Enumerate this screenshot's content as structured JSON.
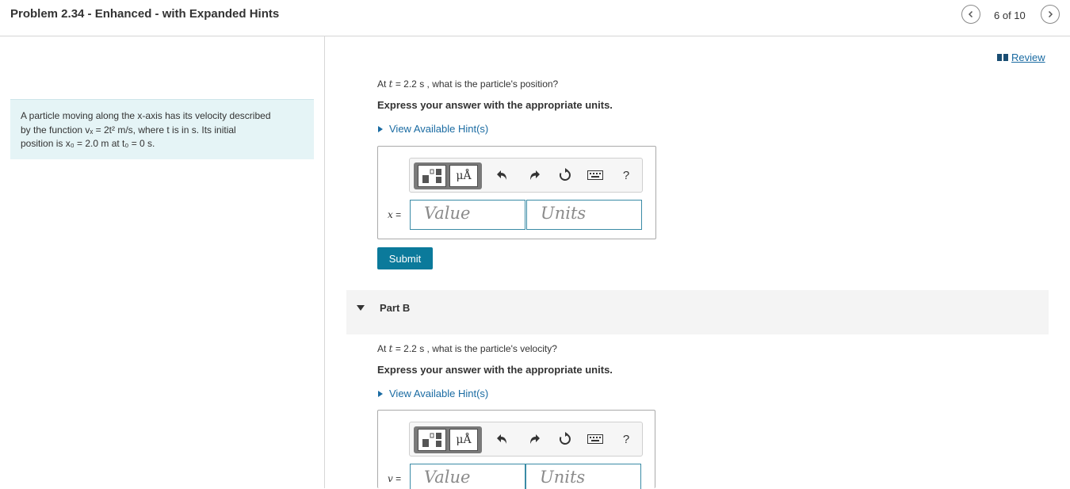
{
  "header": {
    "title": "Problem 2.34 - Enhanced - with Expanded Hints",
    "counter": "6 of 10"
  },
  "problem": {
    "line1": "A particle moving along the x-axis has its velocity described",
    "line2": "by the function vₓ = 2t² m/s, where t is in s. Its initial",
    "line3": "position is x₀ = 2.0 m at t₀ = 0 s."
  },
  "review": {
    "label": "Review"
  },
  "partA": {
    "question_pre": "At ",
    "question_var": "t",
    "question_post": " = 2.2 s , what is the particle's position?",
    "express": "Express your answer with the appropriate units.",
    "hint": "View Available Hint(s)",
    "var_label": "x",
    "value_placeholder": "Value",
    "units_placeholder": "Units",
    "submit": "Submit"
  },
  "partB": {
    "label": "Part B",
    "question_pre": "At ",
    "question_var": "t",
    "question_post": " = 2.2 s , what is the particle's velocity?",
    "express": "Express your answer with the appropriate units.",
    "hint": "View Available Hint(s)",
    "var_label": "v",
    "value_placeholder": "Value",
    "units_placeholder": "Units"
  },
  "toolbar": {
    "units_button": "μÅ",
    "help": "?"
  },
  "icons": {
    "prev": "chevron-left-icon",
    "next": "chevron-right-icon",
    "review": "book-icon",
    "undo": "undo-icon",
    "redo": "redo-icon",
    "reset": "reset-icon",
    "keyboard": "keyboard-icon"
  }
}
